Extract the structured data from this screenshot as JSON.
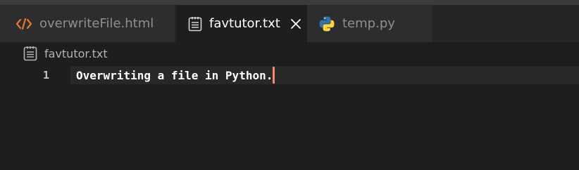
{
  "tabs": [
    {
      "label": "overwriteFile.html",
      "icon": "html-code-icon",
      "state": "inactive"
    },
    {
      "label": "favtutor.txt",
      "icon": "text-file-icon",
      "state": "active",
      "close": "×"
    },
    {
      "label": "temp.py",
      "icon": "python-icon",
      "state": "inactive"
    }
  ],
  "breadcrumb": {
    "label": "favtutor.txt",
    "icon": "text-file-icon"
  },
  "editor": {
    "lines": [
      {
        "number": "1",
        "text": "Overwriting a file in Python."
      }
    ]
  },
  "colors": {
    "html_icon": "#e37933",
    "cursor": "#f08d66",
    "python_blue": "#3572a5",
    "python_yellow": "#ffd43b"
  }
}
